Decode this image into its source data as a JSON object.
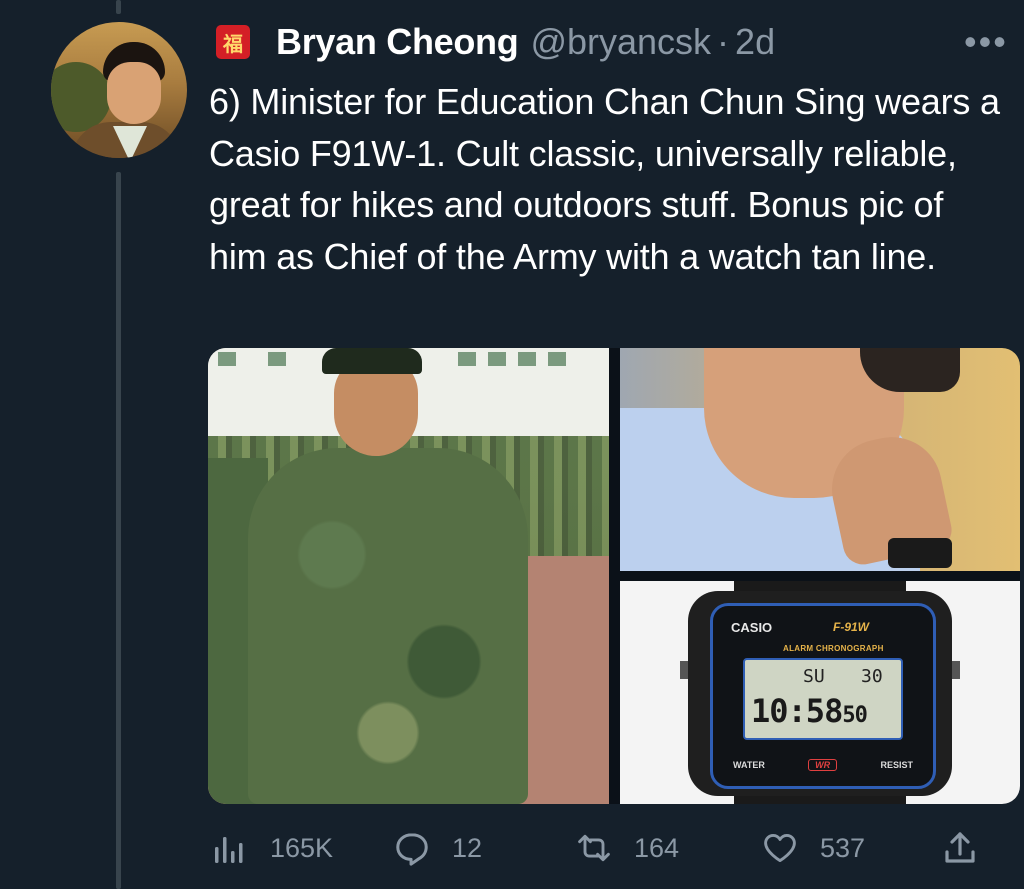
{
  "author": {
    "name": "Bryan Cheong",
    "handle": "@bryancsk",
    "separator": "·",
    "time": "2d",
    "badge_glyph": "福"
  },
  "more_label": "•••",
  "tweet": {
    "text": "6) Minister for Education Chan Chun Sing wears a Casio F91W-1. Cult classic, universally reliable, great for hikes and outdoors stuff. Bonus pic of him as Chief of the Army with a watch tan line."
  },
  "media": {
    "watch": {
      "brand": "CASIO",
      "model": "F-91W",
      "feature": "ALARM CHRONOGRAPH",
      "day": "SU",
      "date": "30",
      "time": "10:58",
      "seconds": "50",
      "water_left": "WATER",
      "water_badge": "WR",
      "water_right": "RESIST"
    }
  },
  "actions": {
    "views": "165K",
    "replies": "12",
    "retweets": "164",
    "likes": "537"
  },
  "colors": {
    "background": "#15202b",
    "secondary_text": "#8b98a5",
    "thread_line": "#38444d"
  }
}
